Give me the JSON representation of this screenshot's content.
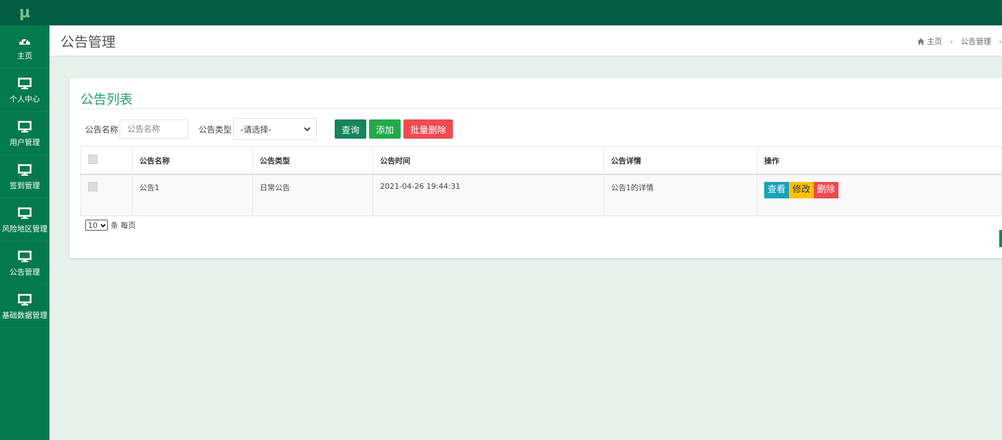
{
  "logo": "μ",
  "sidebar": {
    "items": [
      {
        "label": "主页",
        "icon": "dashboard-icon"
      },
      {
        "label": "个人中心",
        "icon": "monitor-icon"
      },
      {
        "label": "用户管理",
        "icon": "monitor-icon"
      },
      {
        "label": "签到管理",
        "icon": "monitor-icon"
      },
      {
        "label": "风险地区管理",
        "icon": "monitor-icon"
      },
      {
        "label": "公告管理",
        "icon": "monitor-icon"
      },
      {
        "label": "基础数据管理",
        "icon": "monitor-icon"
      }
    ]
  },
  "header": {
    "title": "公告管理",
    "breadcrumb": [
      "主页",
      "公告管理"
    ]
  },
  "panel": {
    "title": "公告列表",
    "search": {
      "name_label": "公告名称",
      "name_placeholder": "公告名称",
      "type_label": "公告类型",
      "type_selected": "-请选择-"
    },
    "buttons": {
      "query": "查询",
      "add": "添加",
      "batch_delete": "批量删除"
    },
    "table": {
      "columns": [
        "公告名称",
        "公告类型",
        "公告时间",
        "公告详情",
        "操作"
      ],
      "rows": [
        {
          "name": "公告1",
          "type": "日常公告",
          "time": "2021-04-26 19:44:31",
          "detail": "公告1的详情",
          "actions": {
            "view": "查看",
            "edit": "修改",
            "delete": "删除"
          }
        }
      ]
    },
    "pager": {
      "page_size": "10",
      "suffix": "条 每页"
    }
  },
  "colors": {
    "topbar": "#025d44",
    "sidebar": "#037a4d",
    "accent": "#28a06a",
    "danger": "#ef4a50",
    "info": "#17a2b8",
    "warning": "#ffc107"
  }
}
